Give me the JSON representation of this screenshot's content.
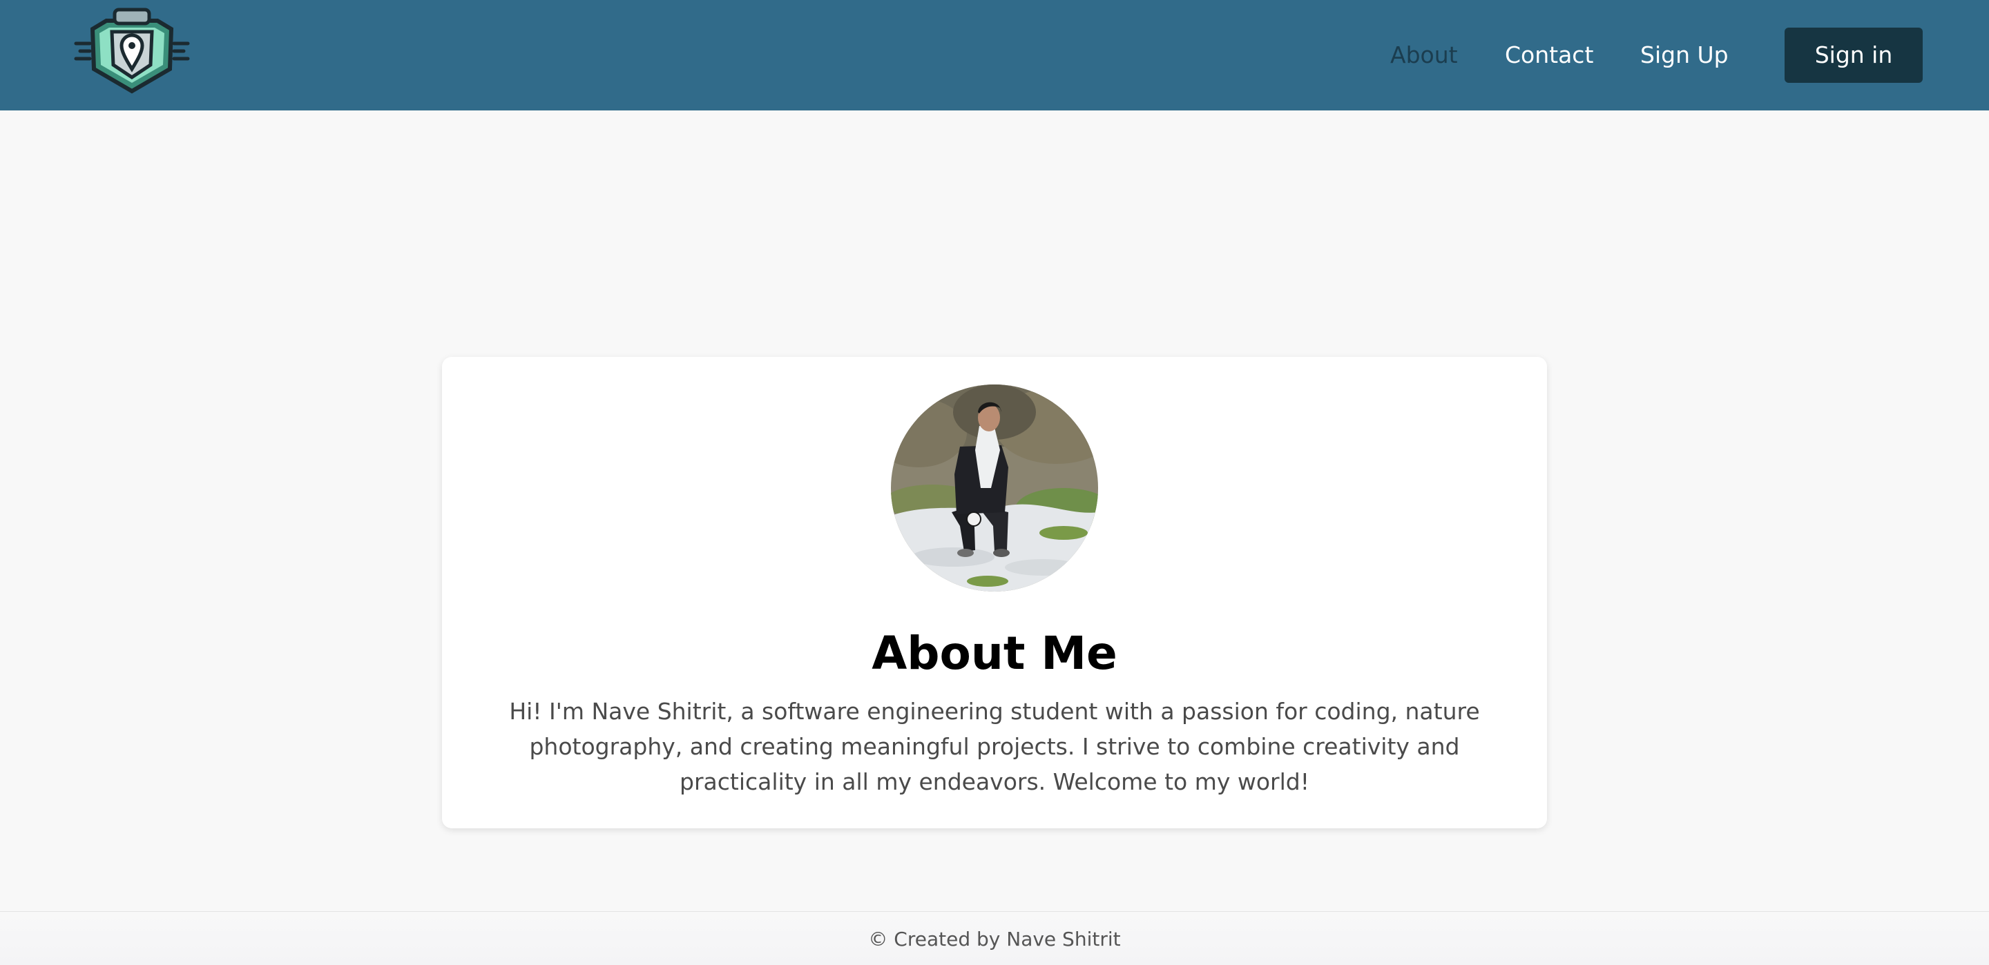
{
  "navbar": {
    "background": "#316b8a",
    "logo_icon": "map-pin-shield-icon",
    "links": [
      {
        "label": "About",
        "active": true
      },
      {
        "label": "Contact",
        "active": false
      },
      {
        "label": "Sign Up",
        "active": false
      }
    ],
    "signin_label": "Sign in"
  },
  "card": {
    "avatar_alt": "profile-photo",
    "title": "About Me",
    "text": "Hi! I'm Nave Shitrit, a software engineering student with a passion for coding, nature photography, and creating meaningful projects. I strive to combine creativity and practicality in all my endeavors. Welcome to my world!"
  },
  "footer": {
    "text": "© Created by Nave Shitrit"
  },
  "colors": {
    "accent": "#316b8a",
    "button": "#163542",
    "page_bg": "#f8f8f8"
  }
}
